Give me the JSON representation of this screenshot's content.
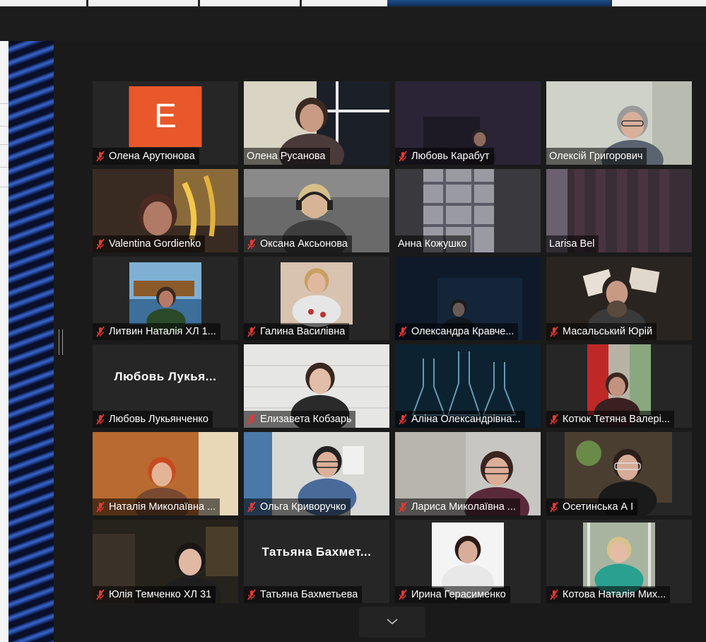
{
  "participants": [
    {
      "name": "Олена Арутюнова",
      "muted": true,
      "avatar_letter": "E",
      "avatar_color": "#e8582a",
      "video": "avatar"
    },
    {
      "name": "Олена Русанова",
      "muted": false,
      "video": "framed-window"
    },
    {
      "name": "Любовь Карабут",
      "muted": true,
      "video": "dark-room"
    },
    {
      "name": "Олексій Григорович",
      "muted": false,
      "active_speaker": true,
      "video": "man-glasses"
    },
    {
      "name": "Valentina Gordienko",
      "muted": true,
      "video": "woman-warm"
    },
    {
      "name": "Оксана Аксьонова",
      "muted": true,
      "video": "headset"
    },
    {
      "name": "Анна Кожушко",
      "muted": false,
      "video": "plaid"
    },
    {
      "name": "Larisa Bel",
      "muted": false,
      "video": "curtains"
    },
    {
      "name": "Литвин Наталія ХЛ 1...",
      "muted": true,
      "video": "photo-sea"
    },
    {
      "name": "Галина Василівна",
      "muted": true,
      "video": "photo-woman"
    },
    {
      "name": "Олександра Кравче...",
      "muted": true,
      "video": "dark-blue"
    },
    {
      "name": "Масальський Юрій",
      "muted": true,
      "video": "man-beard"
    },
    {
      "name": "Любовь Лукьянченко",
      "muted": true,
      "display_text": "Любовь  Лукья...",
      "video": "text"
    },
    {
      "name": "Елизавета Кобзарь",
      "muted": true,
      "video": "girl-white"
    },
    {
      "name": "Аліна Олександрівна...",
      "muted": true,
      "video": "flasks"
    },
    {
      "name": "Котюк Тетяна Валері...",
      "muted": true,
      "video": "framed-red"
    },
    {
      "name": "Наталія Миколаївна ...",
      "muted": true,
      "video": "orange-room"
    },
    {
      "name": "Ольга Криворучко",
      "muted": true,
      "video": "woman-glasses"
    },
    {
      "name": "Лариса Миколаївна ...",
      "muted": true,
      "video": "woman-dark-hair"
    },
    {
      "name": "Осетинська А І",
      "muted": true,
      "video": "framed-older"
    },
    {
      "name": "Юлія Темченко ХЛ 31",
      "muted": true,
      "video": "dark-kitchen"
    },
    {
      "name": "Татьяна Бахметьева",
      "muted": true,
      "display_text": "Татьяна  Бахмет...",
      "video": "text"
    },
    {
      "name": "Ирина Герасименко",
      "muted": true,
      "video": "portrait-photo"
    },
    {
      "name": "Котова Наталія Мих...",
      "muted": true,
      "video": "framed-blonde"
    }
  ],
  "colors": {
    "active_speaker_border": "#d6e34a",
    "muted_icon": "#e53935",
    "tile_bg": "#262626"
  },
  "icons": {
    "muted": "mic-muted-icon",
    "more": "chevron-down-icon"
  }
}
